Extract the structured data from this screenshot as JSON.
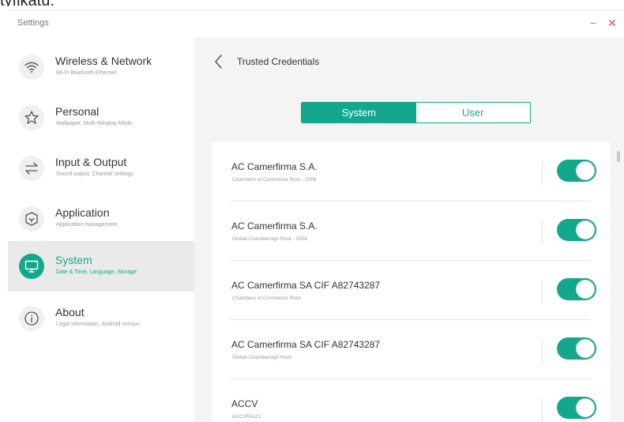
{
  "window": {
    "title": "Settings",
    "minimize_glyph": "−",
    "close_glyph": "✕"
  },
  "sidebar": {
    "items": [
      {
        "label": "Wireless & Network",
        "subtitle": "Wi-Fi Bluetooth Ethernet",
        "icon": "wifi-icon",
        "active": false
      },
      {
        "label": "Personal",
        "subtitle": "Wallpaper, Multi-Window Mode",
        "icon": "star-icon",
        "active": false
      },
      {
        "label": "Input & Output",
        "subtitle": "Sound output, Channel settings",
        "icon": "swap-arrows-icon",
        "active": false
      },
      {
        "label": "Application",
        "subtitle": "Application management",
        "icon": "cube-icon",
        "active": false
      },
      {
        "label": "System",
        "subtitle": "Date & Time, Language, Storage",
        "icon": "monitor-icon",
        "active": true
      },
      {
        "label": "About",
        "subtitle": "Legal information, Android version",
        "icon": "info-icon",
        "active": false
      }
    ]
  },
  "main": {
    "title": "Trusted Credentials",
    "tabs": [
      {
        "label": "System",
        "selected": true
      },
      {
        "label": "User",
        "selected": false
      }
    ],
    "credentials": [
      {
        "name": "AC Camerfirma S.A.",
        "description": "Chambers of Commerce Root - 2008",
        "enabled": true
      },
      {
        "name": "AC Camerfirma S.A.",
        "description": "Global Chambersign Root - 2008",
        "enabled": true
      },
      {
        "name": "AC Camerfirma SA CIF A82743287",
        "description": "Chambers of Commerce Root",
        "enabled": true
      },
      {
        "name": "AC Camerfirma SA CIF A82743287",
        "description": "Global Chambersign Root",
        "enabled": true
      },
      {
        "name": "ACCV",
        "description": "ACCVRAIZ1",
        "enabled": true
      }
    ]
  },
  "colors": {
    "accent": "#13a88c",
    "close": "#e05050",
    "panel_bg": "#f4f4f4",
    "active_item_bg": "#eaeaea"
  }
}
